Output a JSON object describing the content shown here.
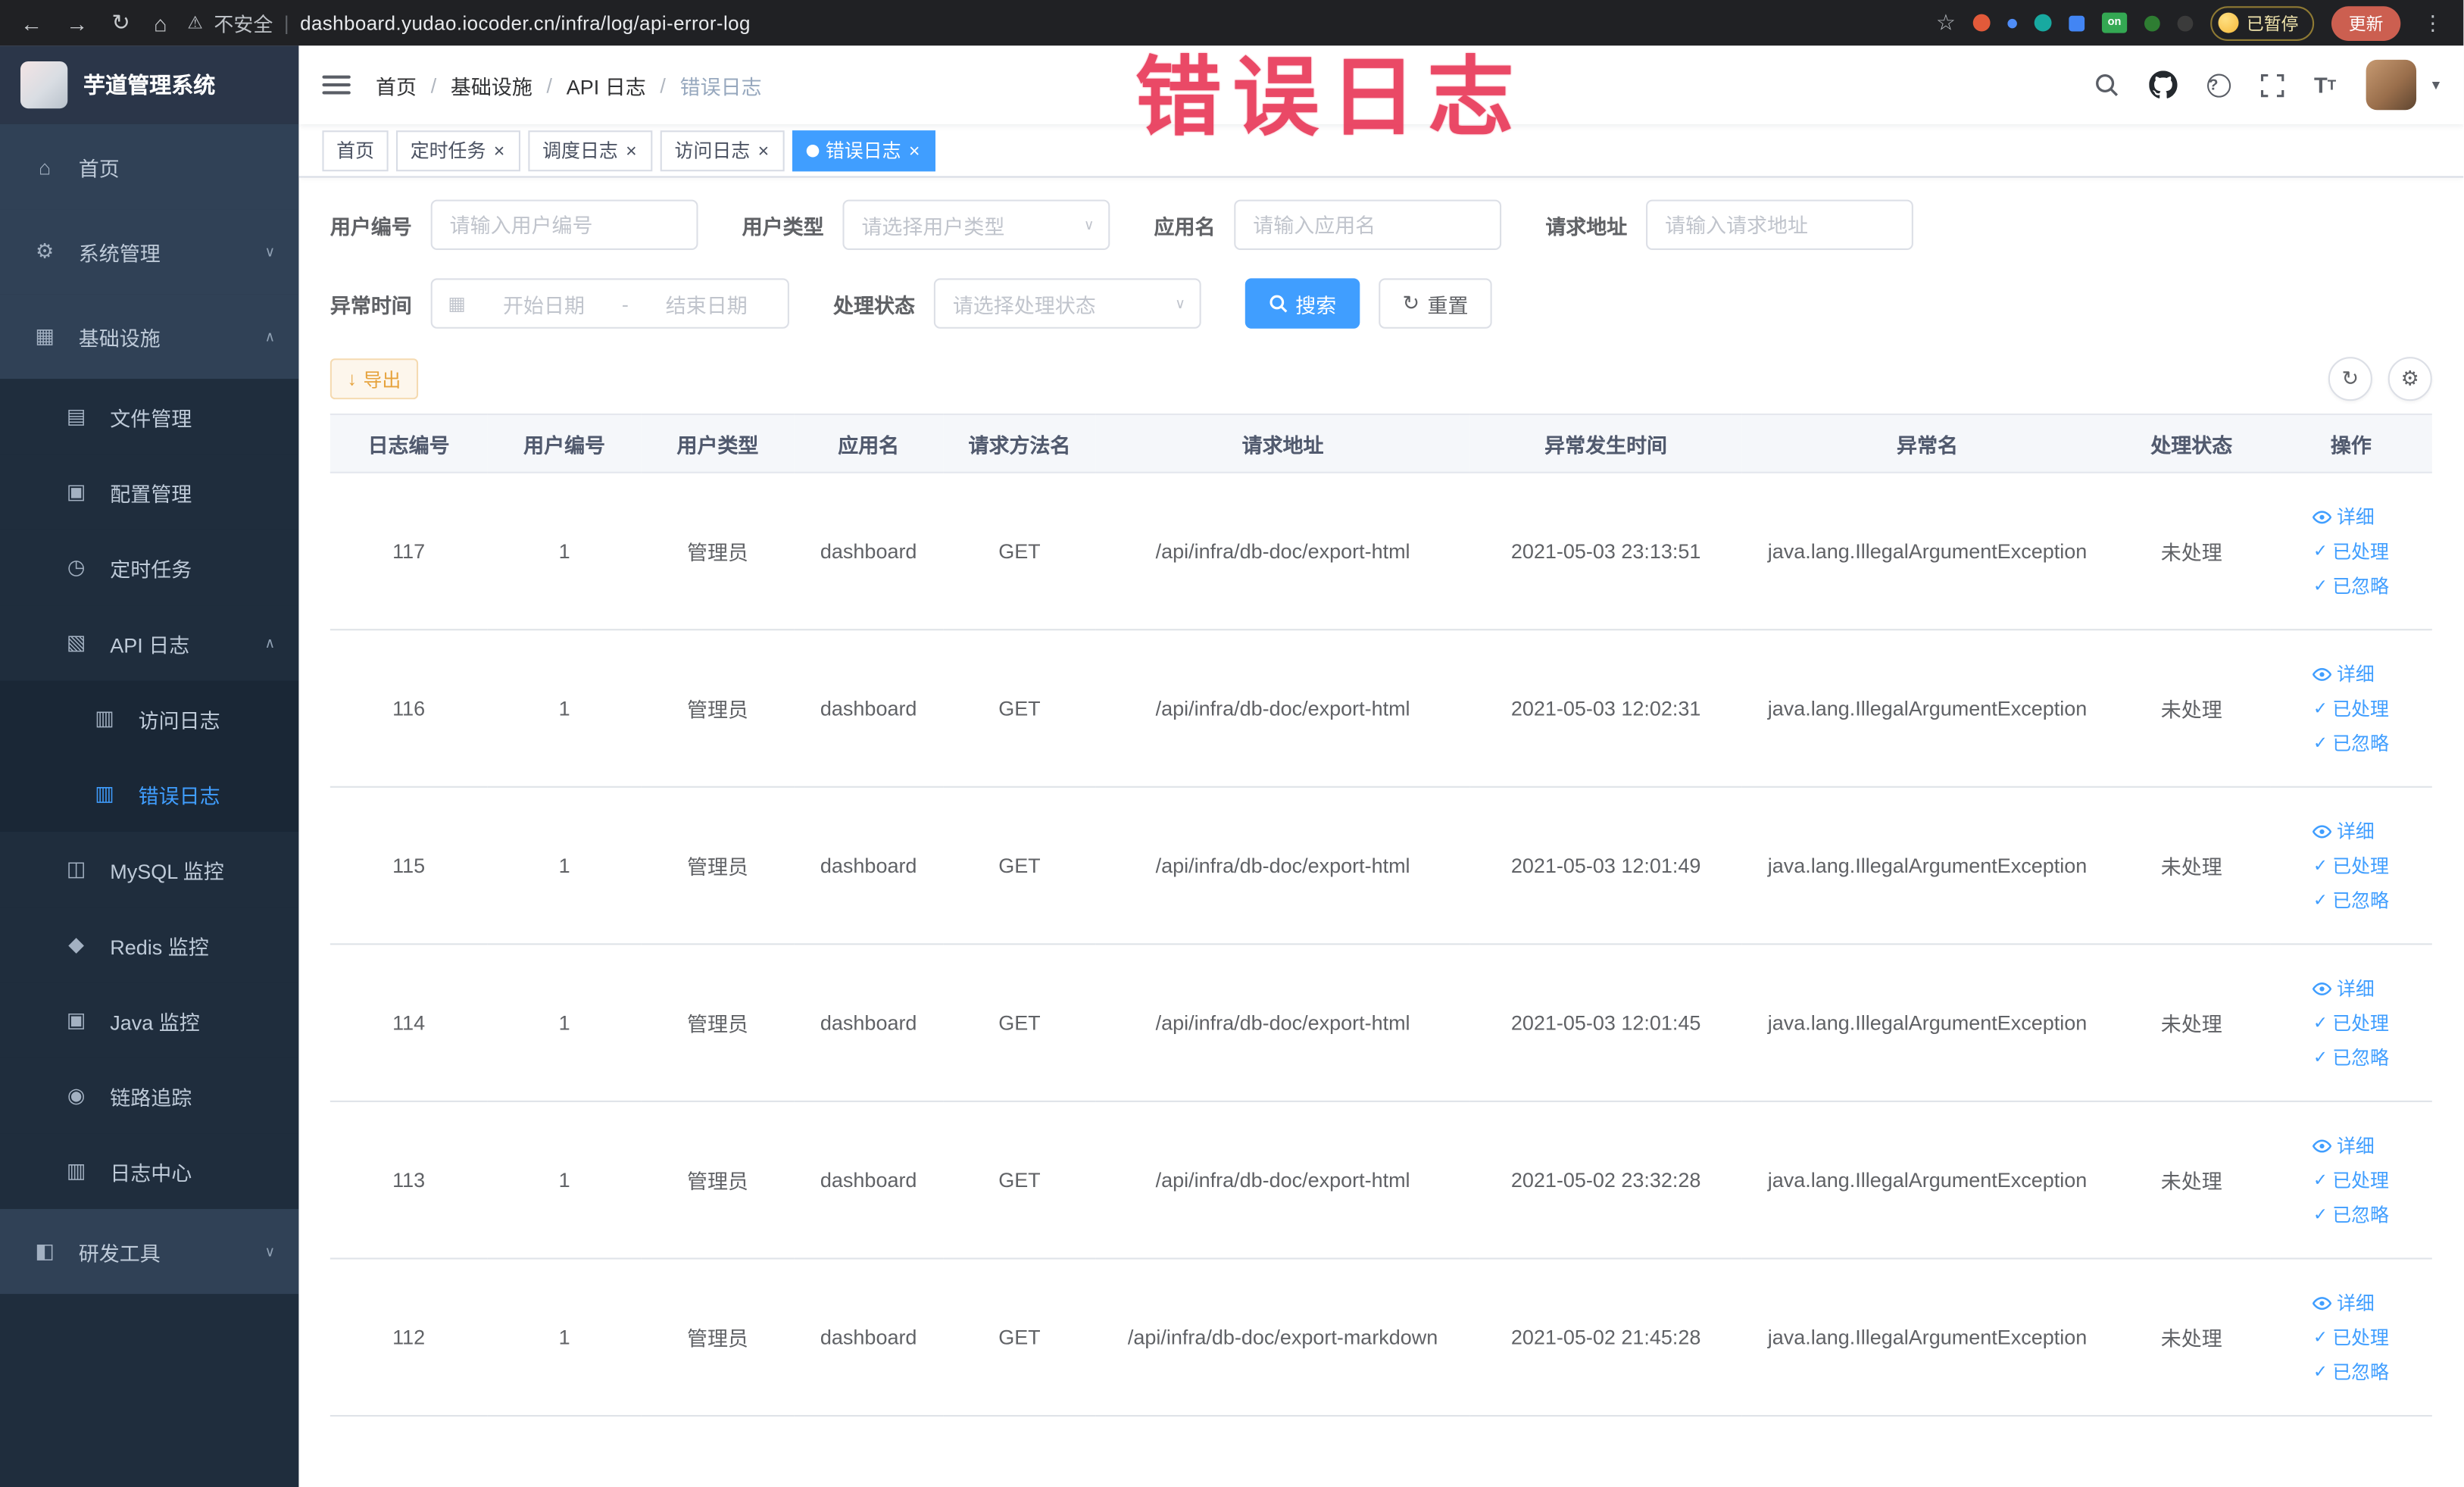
{
  "browser": {
    "security_label": "不安全",
    "url": "dashboard.yudao.iocoder.cn/infra/log/api-error-log",
    "paused_badge": "已暂停",
    "update_button": "更新",
    "ext_on_badge": "on"
  },
  "icons": {
    "back": "←",
    "forward": "→",
    "reload": "↻",
    "home": "⌂",
    "warning": "⚠",
    "divider": "|",
    "bookmark_star": "☆",
    "browser_menu": "⋮",
    "caret_down": "▾",
    "chevron_up": "∧",
    "chevron_down": "∨",
    "close": "×",
    "menu_home": "⌂",
    "menu_system": "⚙",
    "menu_infra": "▦",
    "menu_file": "▤",
    "menu_config": "▣",
    "menu_job": "◷",
    "menu_api_log": "▧",
    "menu_access_log": "▥",
    "menu_error_log": "▥",
    "menu_mysql": "◫",
    "menu_redis": "◆",
    "menu_java": "▣",
    "menu_trace": "◉",
    "menu_log_center": "▥",
    "menu_devtools": "◧",
    "calendar": "▦",
    "refresh": "↻",
    "settings": "⚙",
    "download": "↓",
    "check": "✓",
    "help": "?",
    "font_big": "T",
    "font_small": "T"
  },
  "sidebar": {
    "logo_title": "芋道管理系统",
    "menu": [
      {
        "label": "首页"
      },
      {
        "label": "系统管理"
      },
      {
        "label": "基础设施"
      },
      {
        "label": "文件管理"
      },
      {
        "label": "配置管理"
      },
      {
        "label": "定时任务"
      },
      {
        "label": "API 日志"
      },
      {
        "label": "访问日志"
      },
      {
        "label": "错误日志"
      },
      {
        "label": "MySQL 监控"
      },
      {
        "label": "Redis 监控"
      },
      {
        "label": "Java 监控"
      },
      {
        "label": "链路追踪"
      },
      {
        "label": "日志中心"
      },
      {
        "label": "研发工具"
      }
    ]
  },
  "navbar": {
    "breadcrumb": [
      "首页",
      "基础设施",
      "API 日志",
      "错误日志"
    ]
  },
  "watermark": "错误日志",
  "tabs": [
    {
      "label": "首页"
    },
    {
      "label": "定时任务"
    },
    {
      "label": "调度日志"
    },
    {
      "label": "访问日志"
    },
    {
      "label": "错误日志"
    }
  ],
  "filters": {
    "user_id": {
      "label": "用户编号",
      "placeholder": "请输入用户编号"
    },
    "user_type": {
      "label": "用户类型",
      "placeholder": "请选择用户类型"
    },
    "app_name": {
      "label": "应用名",
      "placeholder": "请输入应用名"
    },
    "request_url": {
      "label": "请求地址",
      "placeholder": "请输入请求地址"
    },
    "exception_time": {
      "label": "异常时间",
      "start_placeholder": "开始日期",
      "separator": "-",
      "end_placeholder": "结束日期"
    },
    "process_status": {
      "label": "处理状态",
      "placeholder": "请选择处理状态"
    },
    "search_button": "搜索",
    "reset_button": "重置"
  },
  "toolbar": {
    "export_button": "导出"
  },
  "table": {
    "columns": [
      "日志编号",
      "用户编号",
      "用户类型",
      "应用名",
      "请求方法名",
      "请求地址",
      "异常发生时间",
      "异常名",
      "处理状态",
      "操作"
    ],
    "actions": {
      "detail": "详细",
      "processed": "已处理",
      "ignored": "已忽略"
    },
    "rows": [
      {
        "id": "117",
        "user_id": "1",
        "user_type": "管理员",
        "app_name": "dashboard",
        "method": "GET",
        "url": "/api/infra/db-doc/export-html",
        "time": "2021-05-03 23:13:51",
        "exception": "java.lang.IllegalArgumentException",
        "status": "未处理"
      },
      {
        "id": "116",
        "user_id": "1",
        "user_type": "管理员",
        "app_name": "dashboard",
        "method": "GET",
        "url": "/api/infra/db-doc/export-html",
        "time": "2021-05-03 12:02:31",
        "exception": "java.lang.IllegalArgumentException",
        "status": "未处理"
      },
      {
        "id": "115",
        "user_id": "1",
        "user_type": "管理员",
        "app_name": "dashboard",
        "method": "GET",
        "url": "/api/infra/db-doc/export-html",
        "time": "2021-05-03 12:01:49",
        "exception": "java.lang.IllegalArgumentException",
        "status": "未处理"
      },
      {
        "id": "114",
        "user_id": "1",
        "user_type": "管理员",
        "app_name": "dashboard",
        "method": "GET",
        "url": "/api/infra/db-doc/export-html",
        "time": "2021-05-03 12:01:45",
        "exception": "java.lang.IllegalArgumentException",
        "status": "未处理"
      },
      {
        "id": "113",
        "user_id": "1",
        "user_type": "管理员",
        "app_name": "dashboard",
        "method": "GET",
        "url": "/api/infra/db-doc/export-html",
        "time": "2021-05-02 23:32:28",
        "exception": "java.lang.IllegalArgumentException",
        "status": "未处理"
      },
      {
        "id": "112",
        "user_id": "1",
        "user_type": "管理员",
        "app_name": "dashboard",
        "method": "GET",
        "url": "/api/infra/db-doc/export-markdown",
        "time": "2021-05-02 21:45:28",
        "exception": "java.lang.IllegalArgumentException",
        "status": "未处理"
      }
    ]
  }
}
